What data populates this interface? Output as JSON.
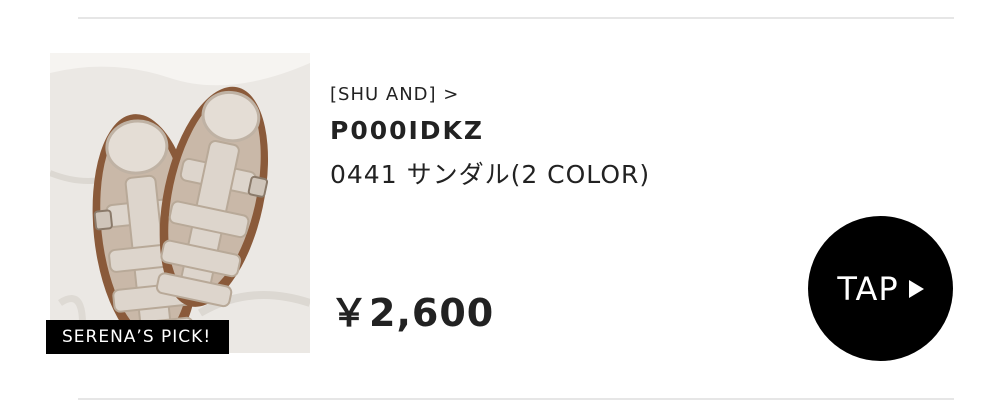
{
  "product": {
    "shop_link": "[SHU AND] >",
    "code": "P000IDKZ",
    "name": "0441 サンダル(2 COLOR)",
    "price": "￥2,600",
    "badge": "SERENA’S PICK!",
    "image_alt": "sandals-photo"
  },
  "cta": {
    "label": "TAP",
    "icon": "play-triangle-icon"
  },
  "colors": {
    "text": "#222222",
    "button_bg": "#000000",
    "button_text": "#ffffff",
    "divider": "#e6e6e6"
  }
}
